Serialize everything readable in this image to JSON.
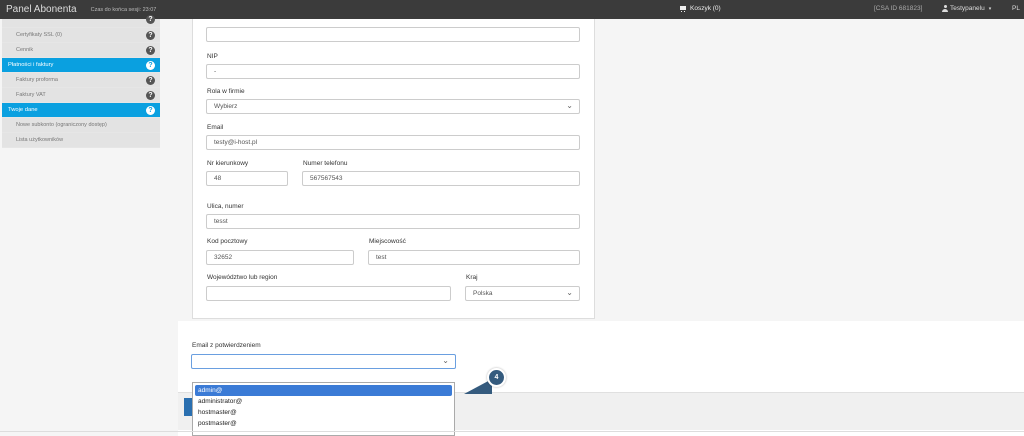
{
  "topbar": {
    "brand": "Panel Abonenta",
    "session": "Czas do końca sesji: 23:07",
    "cart": "Koszyk (0)",
    "csa": "[CSA ID 681823]",
    "user": "Testypanelu",
    "user_caret": "▾",
    "lang": "PL"
  },
  "sidebar": {
    "items": [
      {
        "label": "Certyfikaty SSL (0)"
      },
      {
        "label": "Cennik"
      },
      {
        "label": "Płatności i faktury"
      },
      {
        "label": "Faktury proforma"
      },
      {
        "label": "Faktury VAT"
      },
      {
        "label": "Twoje dane"
      },
      {
        "label": "Nowe subkonto (ograniczony dostęp)"
      },
      {
        "label": "Lista użytkowników"
      }
    ],
    "help_glyph": "?"
  },
  "form": {
    "nip_label": "NIP",
    "nip_value": "-",
    "role_label": "Rola w firmie",
    "role_value": "Wybierz",
    "email_label": "Email",
    "email_value": "testy@i-host.pl",
    "area_label": "Nr kierunkowy",
    "area_value": "48",
    "phone_label": "Numer telefonu",
    "phone_value": "567567543",
    "street_label": "Ulica, numer",
    "street_value": "tesst",
    "zip_label": "Kod pocztowy",
    "zip_value": "32652",
    "city_label": "Miejscowość",
    "city_value": "test",
    "region_label": "Województwo lub region",
    "region_value": "",
    "country_label": "Kraj",
    "country_value": "Polska"
  },
  "confirm": {
    "label": "Email z potwierdzeniem",
    "value": "",
    "options": [
      "admin@",
      "administrator@",
      "hostmaster@",
      "postmaster@"
    ],
    "selected_index": 0
  },
  "badge": "4",
  "colors": {
    "accent": "#0aa0e0",
    "topbar": "#3b3b3b",
    "badge": "#355b7e"
  }
}
